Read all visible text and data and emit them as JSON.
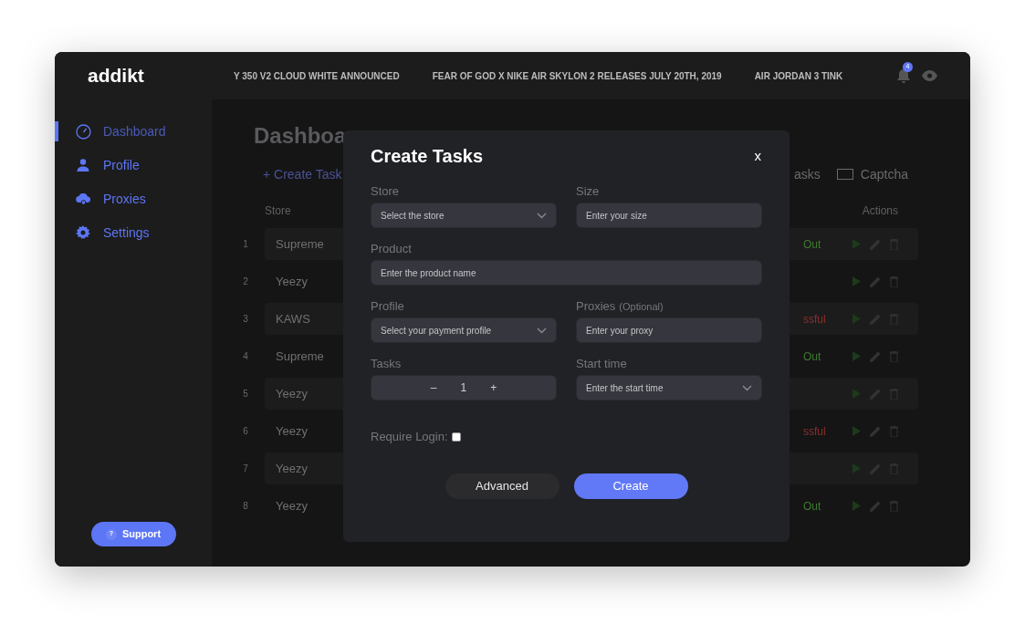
{
  "header": {
    "logo": "addikt",
    "news": [
      "Y 350 V2 CLOUD WHITE ANNOUNCED",
      "FEAR OF GOD X NIKE AIR SKYLON 2 RELEASES JULY 20TH, 2019",
      "AIR JORDAN 3 TINK"
    ],
    "notification_count": "4"
  },
  "sidebar": {
    "items": [
      {
        "label": "Dashboard",
        "selected": true
      },
      {
        "label": "Profile",
        "selected": false
      },
      {
        "label": "Proxies",
        "selected": false
      },
      {
        "label": "Settings",
        "selected": false
      }
    ],
    "support": {
      "icon": "?",
      "label": "Support"
    }
  },
  "dashboard": {
    "title": "Dashboa",
    "create_link": "+ Create Task",
    "tab_fragment": "asks",
    "captcha_tab": "Captcha",
    "table": {
      "columns": [
        "Store",
        "Actions"
      ],
      "rows": [
        {
          "number": "1",
          "store": "Supreme",
          "status": "Out",
          "color": "#3f7a33"
        },
        {
          "number": "2",
          "store": "Yeezy"
        },
        {
          "number": "3",
          "store": "KAWS",
          "status": "ssful",
          "color": "#8a3030"
        },
        {
          "number": "4",
          "store": "Supreme",
          "status": "Out",
          "color": "#3f7a33"
        },
        {
          "number": "5",
          "store": "Yeezy"
        },
        {
          "number": "6",
          "store": "Yeezy",
          "status": "ssful",
          "color": "#8a3030"
        },
        {
          "number": "7",
          "store": "Yeezy"
        },
        {
          "number": "8",
          "store": "Yeezy",
          "status": "Out",
          "color": "#3f7a33"
        }
      ]
    }
  },
  "modal": {
    "title": "Create Tasks",
    "close": "x",
    "fields": [
      {
        "kind": "select",
        "label": "Store",
        "placeholder": "Select the store"
      },
      {
        "kind": "input",
        "label": "Size",
        "placeholder": "Enter your size"
      },
      {
        "kind": "input",
        "label": "Product",
        "placeholder": "Enter the product name"
      },
      {
        "kind": "select",
        "label": "Profile",
        "placeholder": "Select your payment profile"
      },
      {
        "kind": "input",
        "label": "Proxies",
        "note": "(Optional)",
        "placeholder": "Enter your proxy"
      },
      {
        "kind": "stepper",
        "label": "Tasks",
        "value": "1",
        "minus": "–",
        "plus": "+"
      },
      {
        "kind": "select",
        "label": "Start time",
        "placeholder": "Enter the start time"
      }
    ],
    "require_login": {
      "label": "Require Login:",
      "checked": false
    },
    "buttons": [
      {
        "label": "Advanced",
        "kind": "secondary"
      },
      {
        "label": "Create",
        "kind": "primary"
      }
    ]
  }
}
